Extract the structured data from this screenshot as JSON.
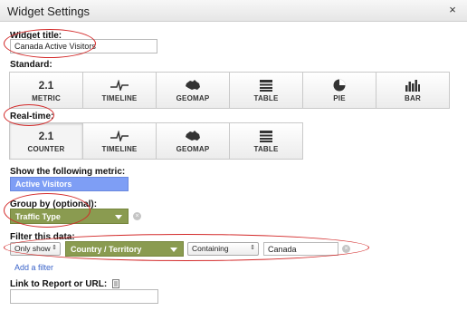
{
  "dialog": {
    "title": "Widget Settings",
    "close_glyph": "×"
  },
  "widget_title": {
    "label": "Widget title:",
    "value": "Canada Active Visitors"
  },
  "standard": {
    "label": "Standard:",
    "options": [
      {
        "icon_text": "2.1",
        "label": "METRIC",
        "icon": "metric-number-icon"
      },
      {
        "icon_text": "",
        "label": "TIMELINE",
        "icon": "timeline-icon"
      },
      {
        "icon_text": "",
        "label": "GEOMAP",
        "icon": "australia-map-icon"
      },
      {
        "icon_text": "",
        "label": "TABLE",
        "icon": "table-icon"
      },
      {
        "icon_text": "",
        "label": "PIE",
        "icon": "pie-chart-icon"
      },
      {
        "icon_text": "",
        "label": "BAR",
        "icon": "bar-chart-icon"
      }
    ]
  },
  "realtime": {
    "label": "Real-time:",
    "options": [
      {
        "icon_text": "2.1",
        "label": "COUNTER",
        "icon": "counter-number-icon"
      },
      {
        "icon_text": "",
        "label": "TIMELINE",
        "icon": "timeline-icon"
      },
      {
        "icon_text": "",
        "label": "GEOMAP",
        "icon": "australia-map-icon"
      },
      {
        "icon_text": "",
        "label": "TABLE",
        "icon": "table-icon"
      }
    ]
  },
  "metric": {
    "label": "Show the following metric:",
    "value": "Active Visitors"
  },
  "group_by": {
    "label": "Group by (optional):",
    "value": "Traffic Type",
    "clear_glyph": "×"
  },
  "filter": {
    "label": "Filter this data:",
    "mode": "Only show",
    "dimension": "Country / Territory",
    "operator": "Containing",
    "value": "Canada",
    "clear_glyph": "×",
    "add_label": "Add a filter"
  },
  "link": {
    "label": "Link to Report or URL:",
    "value": ""
  },
  "colors": {
    "annotation_red": "#d32a2a",
    "metric_blue": "#7e9ef5",
    "dropdown_green": "#8a9b50",
    "link_blue": "#3a63c9"
  }
}
